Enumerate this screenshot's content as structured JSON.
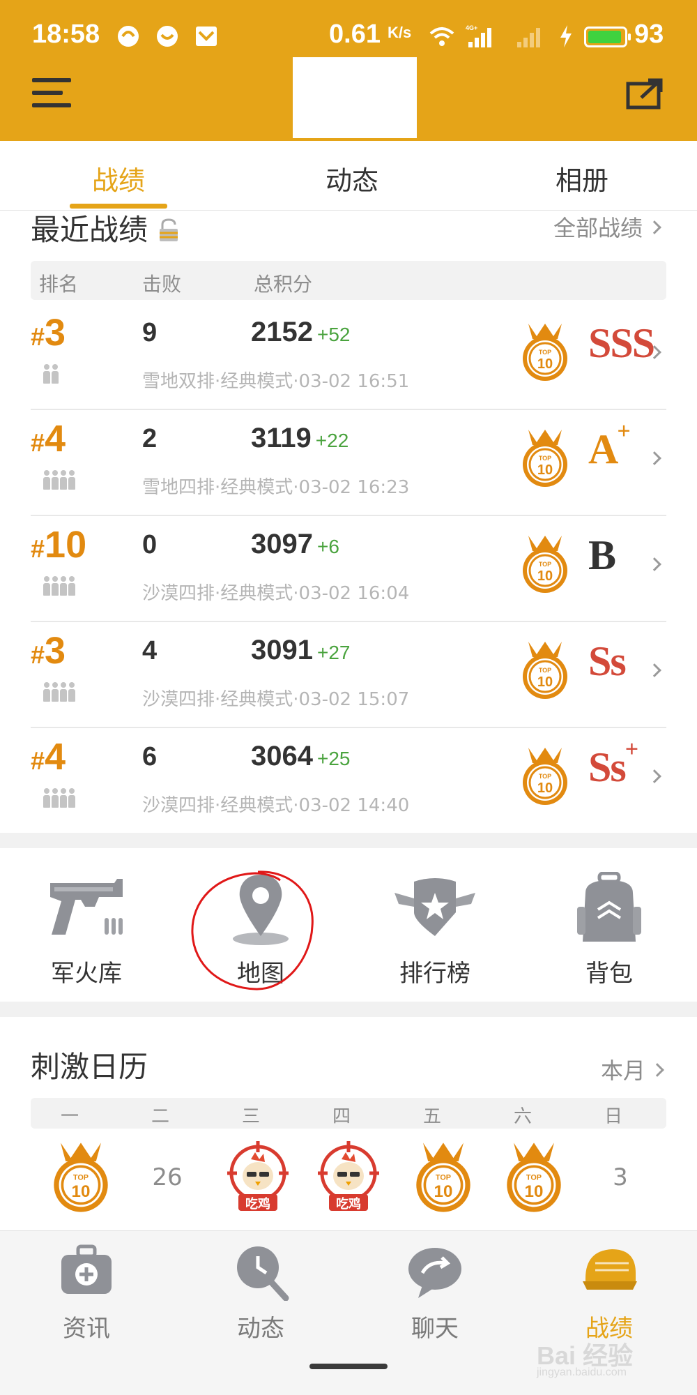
{
  "status_bar": {
    "time": "18:58",
    "net_speed": "0.61",
    "net_speed_unit": "K/s",
    "battery_level": 0.93,
    "battery_text": "93",
    "network": "4G+"
  },
  "tabs": [
    {
      "label": "战绩",
      "active": true
    },
    {
      "label": "动态",
      "active": false
    },
    {
      "label": "相册",
      "active": false
    }
  ],
  "recent": {
    "title": "最近战绩",
    "more_label": "全部战绩",
    "columns": {
      "rank": "排名",
      "kills": "击败",
      "score": "总积分"
    },
    "rows": [
      {
        "rank_hash": "#",
        "rank": "3",
        "players": 2,
        "kills": "9",
        "score": "2152",
        "delta": "+52",
        "meta": "雪地双排·经典模式·03-02 16:51",
        "grade": "SSS",
        "grade_plus": ""
      },
      {
        "rank_hash": "#",
        "rank": "4",
        "players": 4,
        "kills": "2",
        "score": "3119",
        "delta": "+22",
        "meta": "雪地四排·经典模式·03-02 16:23",
        "grade": "A",
        "grade_plus": "+"
      },
      {
        "rank_hash": "#",
        "rank": "10",
        "players": 4,
        "kills": "0",
        "score": "3097",
        "delta": "+6",
        "meta": "沙漠四排·经典模式·03-02 16:04",
        "grade": "B",
        "grade_plus": ""
      },
      {
        "rank_hash": "#",
        "rank": "3",
        "players": 4,
        "kills": "4",
        "score": "3091",
        "delta": "+27",
        "meta": "沙漠四排·经典模式·03-02 15:07",
        "grade": "Ss",
        "grade_plus": ""
      },
      {
        "rank_hash": "#",
        "rank": "4",
        "players": 4,
        "kills": "6",
        "score": "3064",
        "delta": "+25",
        "meta": "沙漠四排·经典模式·03-02 14:40",
        "grade": "Ss",
        "grade_plus": "+"
      }
    ]
  },
  "features": [
    {
      "label": "军火库",
      "icon": "gun-icon"
    },
    {
      "label": "地图",
      "icon": "map-pin-icon"
    },
    {
      "label": "排行榜",
      "icon": "shield-star-icon"
    },
    {
      "label": "背包",
      "icon": "backpack-icon"
    }
  ],
  "calendar": {
    "title": "刺激日历",
    "more_label": "本月",
    "weekdays": [
      "一",
      "二",
      "三",
      "四",
      "五",
      "六",
      "日"
    ],
    "cells": [
      {
        "type": "top10",
        "text": ""
      },
      {
        "type": "date",
        "text": "26"
      },
      {
        "type": "chicken",
        "text": "吃鸡"
      },
      {
        "type": "chicken",
        "text": "吃鸡"
      },
      {
        "type": "top10",
        "text": ""
      },
      {
        "type": "top10",
        "text": ""
      },
      {
        "type": "date",
        "text": "3"
      }
    ]
  },
  "bottom_nav": [
    {
      "label": "资讯",
      "icon": "medkit-icon",
      "active": false
    },
    {
      "label": "动态",
      "icon": "pan-icon",
      "active": false
    },
    {
      "label": "聊天",
      "icon": "chat-icon",
      "active": false
    },
    {
      "label": "战绩",
      "icon": "helmet-icon",
      "active": true
    }
  ],
  "watermark": {
    "main": "Bai 经验",
    "sub": "jingyan.baidu.com"
  },
  "colors": {
    "accent": "#e5a418",
    "rank": "#e28a10",
    "delta": "#4aa33e",
    "grade_red": "#d34a3a",
    "annotation_red": "#e01818"
  }
}
